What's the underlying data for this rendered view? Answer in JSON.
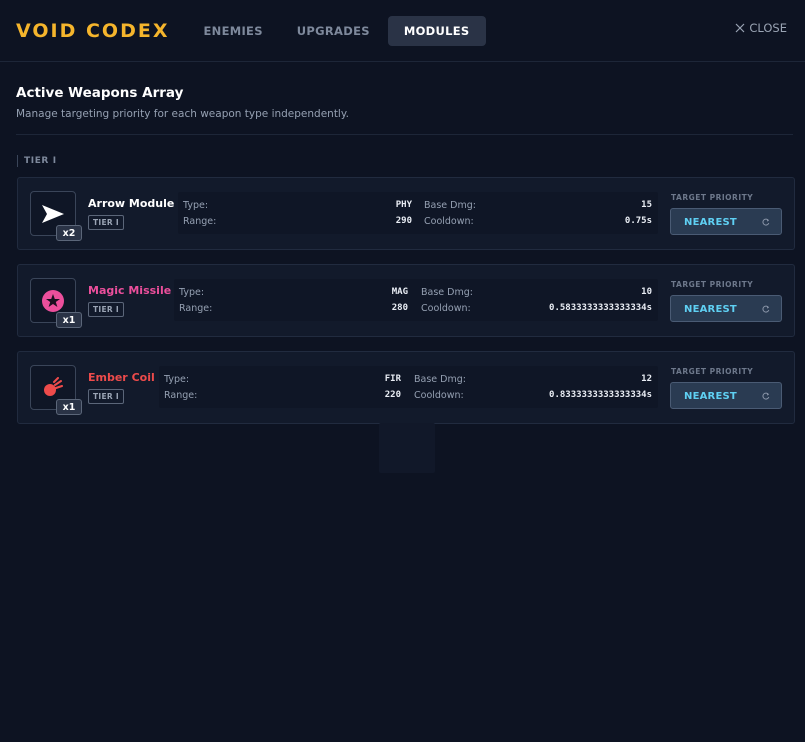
{
  "app": {
    "logo": "VOID CODEX"
  },
  "tabs": [
    {
      "label": "ENEMIES",
      "active": false
    },
    {
      "label": "UPGRADES",
      "active": false
    },
    {
      "label": "MODULES",
      "active": true
    }
  ],
  "close_label": "CLOSE",
  "intro": {
    "title": "Active Weapons Array",
    "description": "Manage targeting priority for each weapon type independently."
  },
  "tier_section": "TIER I",
  "labels": {
    "type": "Type:",
    "range": "Range:",
    "base_dmg": "Base Dmg:",
    "cooldown": "Cooldown:",
    "target_priority": "TARGET PRIORITY"
  },
  "weapons": [
    {
      "name": "Arrow Module",
      "name_color": "#ffffff",
      "icon": "arrow-icon",
      "count": "x2",
      "tier": "TIER I",
      "type": "PHY",
      "range": "290",
      "base_dmg": "15",
      "cooldown": "0.75s",
      "priority": "NEAREST"
    },
    {
      "name": "Magic Missile",
      "name_color": "#ec4f9c",
      "icon": "star-orb-icon",
      "count": "x1",
      "tier": "TIER I",
      "type": "MAG",
      "range": "280",
      "base_dmg": "10",
      "cooldown": "0.5833333333333334s",
      "priority": "NEAREST"
    },
    {
      "name": "Ember Coil",
      "name_color": "#ee4b4b",
      "icon": "fireball-icon",
      "count": "x1",
      "tier": "TIER I",
      "type": "FIR",
      "range": "220",
      "base_dmg": "12",
      "cooldown": "0.8333333333333334s",
      "priority": "NEAREST"
    }
  ],
  "colors": {
    "accent": "#f5b52c",
    "priority_text": "#5fd0f3",
    "background": "#0d1322"
  }
}
